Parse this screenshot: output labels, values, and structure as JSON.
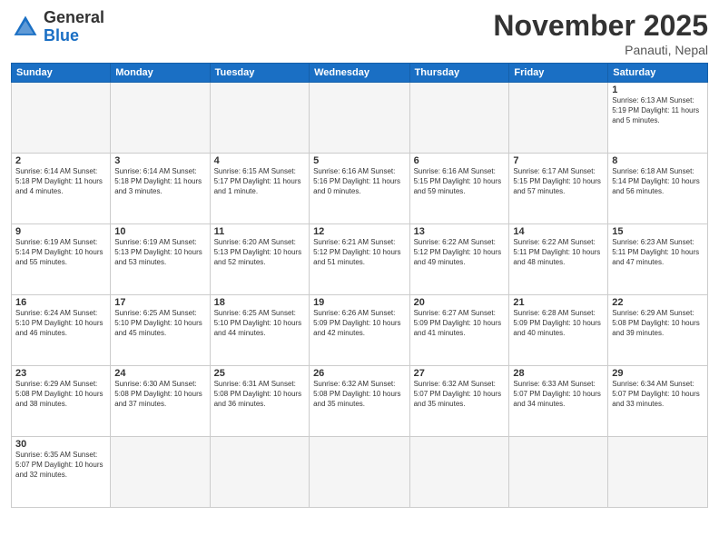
{
  "logo": {
    "general": "General",
    "blue": "Blue"
  },
  "title": {
    "month": "November 2025",
    "location": "Panauti, Nepal"
  },
  "days_of_week": [
    "Sunday",
    "Monday",
    "Tuesday",
    "Wednesday",
    "Thursday",
    "Friday",
    "Saturday"
  ],
  "weeks": [
    [
      {
        "day": "",
        "info": ""
      },
      {
        "day": "",
        "info": ""
      },
      {
        "day": "",
        "info": ""
      },
      {
        "day": "",
        "info": ""
      },
      {
        "day": "",
        "info": ""
      },
      {
        "day": "",
        "info": ""
      },
      {
        "day": "1",
        "info": "Sunrise: 6:13 AM\nSunset: 5:19 PM\nDaylight: 11 hours and 5 minutes."
      }
    ],
    [
      {
        "day": "2",
        "info": "Sunrise: 6:14 AM\nSunset: 5:18 PM\nDaylight: 11 hours and 4 minutes."
      },
      {
        "day": "3",
        "info": "Sunrise: 6:14 AM\nSunset: 5:18 PM\nDaylight: 11 hours and 3 minutes."
      },
      {
        "day": "4",
        "info": "Sunrise: 6:15 AM\nSunset: 5:17 PM\nDaylight: 11 hours and 1 minute."
      },
      {
        "day": "5",
        "info": "Sunrise: 6:16 AM\nSunset: 5:16 PM\nDaylight: 11 hours and 0 minutes."
      },
      {
        "day": "6",
        "info": "Sunrise: 6:16 AM\nSunset: 5:15 PM\nDaylight: 10 hours and 59 minutes."
      },
      {
        "day": "7",
        "info": "Sunrise: 6:17 AM\nSunset: 5:15 PM\nDaylight: 10 hours and 57 minutes."
      },
      {
        "day": "8",
        "info": "Sunrise: 6:18 AM\nSunset: 5:14 PM\nDaylight: 10 hours and 56 minutes."
      }
    ],
    [
      {
        "day": "9",
        "info": "Sunrise: 6:19 AM\nSunset: 5:14 PM\nDaylight: 10 hours and 55 minutes."
      },
      {
        "day": "10",
        "info": "Sunrise: 6:19 AM\nSunset: 5:13 PM\nDaylight: 10 hours and 53 minutes."
      },
      {
        "day": "11",
        "info": "Sunrise: 6:20 AM\nSunset: 5:13 PM\nDaylight: 10 hours and 52 minutes."
      },
      {
        "day": "12",
        "info": "Sunrise: 6:21 AM\nSunset: 5:12 PM\nDaylight: 10 hours and 51 minutes."
      },
      {
        "day": "13",
        "info": "Sunrise: 6:22 AM\nSunset: 5:12 PM\nDaylight: 10 hours and 49 minutes."
      },
      {
        "day": "14",
        "info": "Sunrise: 6:22 AM\nSunset: 5:11 PM\nDaylight: 10 hours and 48 minutes."
      },
      {
        "day": "15",
        "info": "Sunrise: 6:23 AM\nSunset: 5:11 PM\nDaylight: 10 hours and 47 minutes."
      }
    ],
    [
      {
        "day": "16",
        "info": "Sunrise: 6:24 AM\nSunset: 5:10 PM\nDaylight: 10 hours and 46 minutes."
      },
      {
        "day": "17",
        "info": "Sunrise: 6:25 AM\nSunset: 5:10 PM\nDaylight: 10 hours and 45 minutes."
      },
      {
        "day": "18",
        "info": "Sunrise: 6:25 AM\nSunset: 5:10 PM\nDaylight: 10 hours and 44 minutes."
      },
      {
        "day": "19",
        "info": "Sunrise: 6:26 AM\nSunset: 5:09 PM\nDaylight: 10 hours and 42 minutes."
      },
      {
        "day": "20",
        "info": "Sunrise: 6:27 AM\nSunset: 5:09 PM\nDaylight: 10 hours and 41 minutes."
      },
      {
        "day": "21",
        "info": "Sunrise: 6:28 AM\nSunset: 5:09 PM\nDaylight: 10 hours and 40 minutes."
      },
      {
        "day": "22",
        "info": "Sunrise: 6:29 AM\nSunset: 5:08 PM\nDaylight: 10 hours and 39 minutes."
      }
    ],
    [
      {
        "day": "23",
        "info": "Sunrise: 6:29 AM\nSunset: 5:08 PM\nDaylight: 10 hours and 38 minutes."
      },
      {
        "day": "24",
        "info": "Sunrise: 6:30 AM\nSunset: 5:08 PM\nDaylight: 10 hours and 37 minutes."
      },
      {
        "day": "25",
        "info": "Sunrise: 6:31 AM\nSunset: 5:08 PM\nDaylight: 10 hours and 36 minutes."
      },
      {
        "day": "26",
        "info": "Sunrise: 6:32 AM\nSunset: 5:08 PM\nDaylight: 10 hours and 35 minutes."
      },
      {
        "day": "27",
        "info": "Sunrise: 6:32 AM\nSunset: 5:07 PM\nDaylight: 10 hours and 35 minutes."
      },
      {
        "day": "28",
        "info": "Sunrise: 6:33 AM\nSunset: 5:07 PM\nDaylight: 10 hours and 34 minutes."
      },
      {
        "day": "29",
        "info": "Sunrise: 6:34 AM\nSunset: 5:07 PM\nDaylight: 10 hours and 33 minutes."
      }
    ],
    [
      {
        "day": "30",
        "info": "Sunrise: 6:35 AM\nSunset: 5:07 PM\nDaylight: 10 hours and 32 minutes."
      },
      {
        "day": "",
        "info": ""
      },
      {
        "day": "",
        "info": ""
      },
      {
        "day": "",
        "info": ""
      },
      {
        "day": "",
        "info": ""
      },
      {
        "day": "",
        "info": ""
      },
      {
        "day": "",
        "info": ""
      }
    ]
  ]
}
